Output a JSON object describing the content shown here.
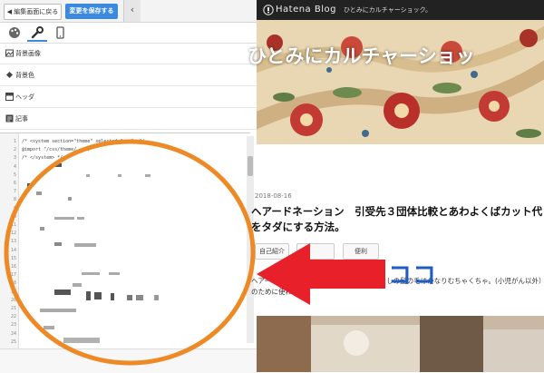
{
  "toolbar": {
    "back_label": "編集画面に戻る",
    "save_label": "変更を保存する"
  },
  "tabs": [
    {
      "name": "theme",
      "icon": "palette-icon"
    },
    {
      "name": "design",
      "icon": "wrench-icon",
      "active": true
    },
    {
      "name": "mobile",
      "icon": "mobile-icon"
    }
  ],
  "sidebar": {
    "items": [
      {
        "label": "背景画像",
        "icon": "image-icon"
      },
      {
        "label": "背景色",
        "icon": "paint-icon"
      },
      {
        "label": "ヘッダ",
        "icon": "header-icon"
      },
      {
        "label": "記事",
        "icon": "article-icon"
      }
    ]
  },
  "code": {
    "line_numbers": [
      "1",
      "2",
      "3",
      "4",
      "5",
      "6",
      "7",
      "8",
      "9",
      "10",
      "11",
      "12",
      "13",
      "14",
      "15",
      "16",
      "17",
      "18",
      "19",
      "20",
      "21",
      "22",
      "23",
      "24",
      "25"
    ],
    "line1": "/* <system section=\"theme\" selected=\"...\"> */",
    "line2": "@import \"/css/theme/...\";",
    "line3": "/* </system> */"
  },
  "preview": {
    "brand": "Hatena Blog",
    "blog_name_small": "ひとみにカルチャーショック。",
    "blog_title": "ひとみにカルチャーショッ",
    "date": "2018-08-16",
    "post_title": "ヘアードネーション　引受先３団体比較とあわよくばカット代をタダにする方法。",
    "chips": [
      "自己紹介",
      "",
      "便利"
    ],
    "excerpt": "ヘアードネーションのお話しですが…、わたしの髪の毛はかなりむちゃくちゃ。(小児がん以外）のために使われる。"
  },
  "annotation": {
    "koko": "ココ",
    "ring_color": "#ee8a26",
    "arrow_color": "#e8202a",
    "koko_color": "#1f5cc4"
  },
  "colors": {
    "accent": "#3c8ae0",
    "header_dark": "#222222"
  }
}
